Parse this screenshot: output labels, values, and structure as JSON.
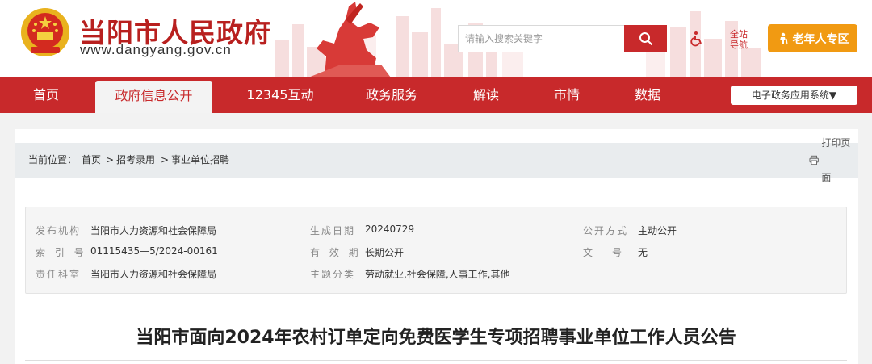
{
  "header": {
    "site_title": "当阳市人民政府",
    "site_url": "www.dangyang.gov.cn",
    "search_placeholder": "请输入搜索关键字",
    "guide_line1": "全站",
    "guide_line2": "导航",
    "elder_label": "老年人专区",
    "brand_color": "#c8292b",
    "elder_color": "#f19a12"
  },
  "nav": {
    "items": [
      "首页",
      "政府信息公开",
      "12345互动",
      "政务服务",
      "解读",
      "市情",
      "数据"
    ],
    "active": "政府信息公开",
    "system_select": "电子政务应用系统▼"
  },
  "breadcrumb": {
    "prefix": "当前位置：",
    "items": [
      "首页",
      "招考录用",
      "事业单位招聘"
    ],
    "separator": ">",
    "print_label": "打印页面"
  },
  "meta": {
    "publisher_label": "发布机构",
    "publisher": "当阳市人力资源和社会保障局",
    "date_label": "生成日期",
    "date": "20240729",
    "open_label": "公开方式",
    "open_mode": "主动公开",
    "index_label": "索 引 号",
    "index_no": "01115435—5/2024-00161",
    "valid_label": "有 效 期",
    "valid": "长期公开",
    "doc_no_label": "文　　号",
    "doc_no": "无",
    "dept_label": "责任科室",
    "dept": "当阳市人力资源和社会保障局",
    "topic_label": "主题分类",
    "topic": "劳动就业,社会保障,人事工作,其他"
  },
  "document": {
    "title": "当阳市面向2024年农村订单定向免费医学生专项招聘事业单位工作人员公告"
  }
}
